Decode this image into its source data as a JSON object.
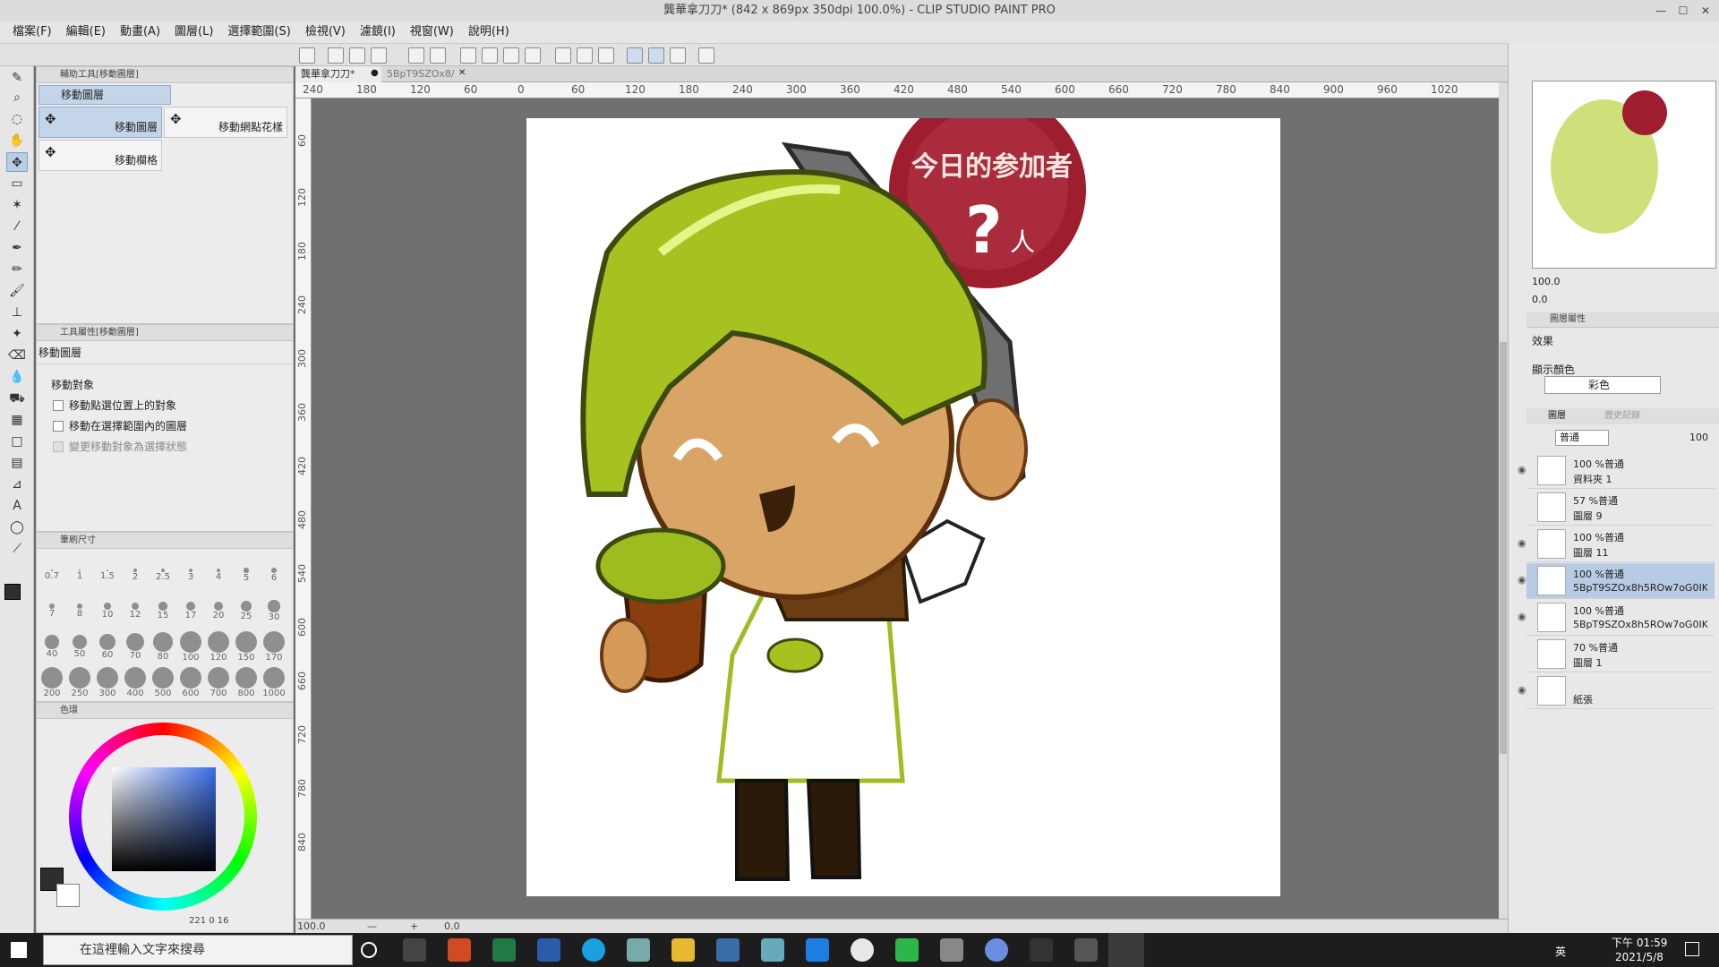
{
  "window": {
    "title": "龔華拿刀刀* (842 x 869px 350dpi 100.0%)  - CLIP STUDIO PAINT PRO"
  },
  "menu": [
    "檔案(F)",
    "編輯(E)",
    "動畫(A)",
    "圖層(L)",
    "選擇範圍(S)",
    "檢視(V)",
    "濾鏡(I)",
    "視窗(W)",
    "說明(H)"
  ],
  "subtool": {
    "panel_title": "輔助工具[移動圖層]",
    "group": "移動圖層",
    "items": [
      "移動圖層",
      "移動網點花樣",
      "移動欄格"
    ]
  },
  "tool_property": {
    "panel_title": "工具屬性[移動圖層]",
    "name": "移動圖層",
    "target_label": "移動對象",
    "options": [
      "移動點選位置上的對象",
      "移動在選擇範圍內的圖層",
      "變更移動對象為選擇狀態"
    ]
  },
  "brush_size": {
    "panel_title": "筆刷尺寸",
    "sizes": [
      "0.7",
      "1",
      "1.5",
      "2",
      "2.5",
      "3",
      "4",
      "5",
      "6",
      "7",
      "8",
      "10",
      "12",
      "15",
      "17",
      "20",
      "25",
      "30",
      "40",
      "50",
      "60",
      "70",
      "80",
      "100",
      "120",
      "150",
      "170",
      "200",
      "250",
      "300",
      "400",
      "500",
      "600",
      "700",
      "800",
      "1000"
    ]
  },
  "color": {
    "panel_title": "色環",
    "values": "221 0 16",
    "main": "#2e2e2e",
    "sub": "#ffffff"
  },
  "canvas": {
    "tabs": [
      "龔華拿刀刀*",
      "5BpT9SZOx8/"
    ],
    "ruler_top": [
      "240",
      "180",
      "120",
      "60",
      "0",
      "60",
      "120",
      "180",
      "240",
      "300",
      "360",
      "420",
      "480",
      "540",
      "600",
      "660",
      "720",
      "780",
      "840",
      "900",
      "960",
      "1020"
    ],
    "ruler_left": [
      "60",
      "120",
      "180",
      "240",
      "300",
      "360",
      "420",
      "480",
      "540",
      "600",
      "660",
      "720",
      "780",
      "840"
    ],
    "zoom": "100.0",
    "angle": "0.0",
    "badge_line1": "今日的参加者",
    "badge_line2": "?",
    "badge_line3": "人"
  },
  "navigator": {
    "zoom": "100.0",
    "angle": "0.0"
  },
  "layer_property": {
    "panel_title": "圖層屬性",
    "effect_label": "效果",
    "color_label": "顯示顏色",
    "color_value": "彩色"
  },
  "layers": {
    "tab1": "圖層",
    "tab2": "歷史記錄",
    "blend": "普通",
    "opacity": "100",
    "items": [
      {
        "line1": "100 %普通",
        "line2": "資料夾 1"
      },
      {
        "line1": "57 %普通",
        "line2": "圖層 9"
      },
      {
        "line1": "100 %普通",
        "line2": "圖層 11"
      },
      {
        "line1": "100 %普通",
        "line2": "5BpT9SZOx8h5ROw7oG0IK"
      },
      {
        "line1": "100 %普通",
        "line2": "5BpT9SZOx8h5ROw7oG0IK"
      },
      {
        "line1": "70 %普通",
        "line2": "圖層 1"
      },
      {
        "line1": "",
        "line2": "紙張"
      }
    ]
  },
  "taskbar": {
    "search_placeholder": "在這裡輸入文字來搜尋",
    "ime": "英",
    "time": "下午 01:59",
    "date": "2021/5/8"
  }
}
